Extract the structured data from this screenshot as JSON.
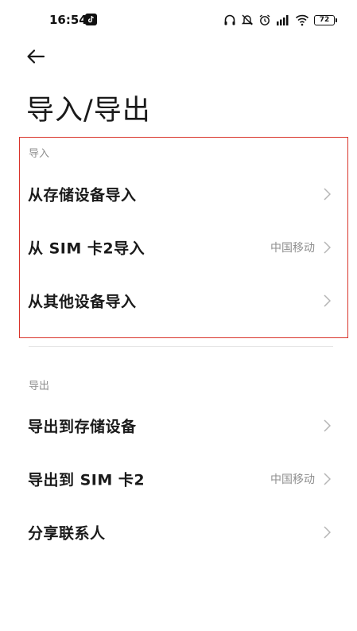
{
  "status_bar": {
    "time": "16:54",
    "battery": "72"
  },
  "header": {
    "title": "导入/导出"
  },
  "import_section": {
    "header": "导入",
    "items": [
      {
        "label": "从存储设备导入",
        "value": ""
      },
      {
        "label": "从 SIM 卡2导入",
        "value": "中国移动"
      },
      {
        "label": "从其他设备导入",
        "value": ""
      }
    ]
  },
  "export_section": {
    "header": "导出",
    "items": [
      {
        "label": "导出到存储设备",
        "value": ""
      },
      {
        "label": "导出到 SIM 卡2",
        "value": "中国移动"
      },
      {
        "label": "分享联系人",
        "value": ""
      }
    ]
  },
  "icons": {
    "back": "back-arrow-icon",
    "chevron": "chevron-right-icon",
    "status": [
      "tiktok-icon",
      "headphones-icon",
      "mute-icon",
      "alarm-icon",
      "signal-icon",
      "wifi-icon",
      "battery-icon"
    ]
  },
  "colors": {
    "highlight": "#d9342b",
    "secondary_text": "#8f8f8f"
  }
}
